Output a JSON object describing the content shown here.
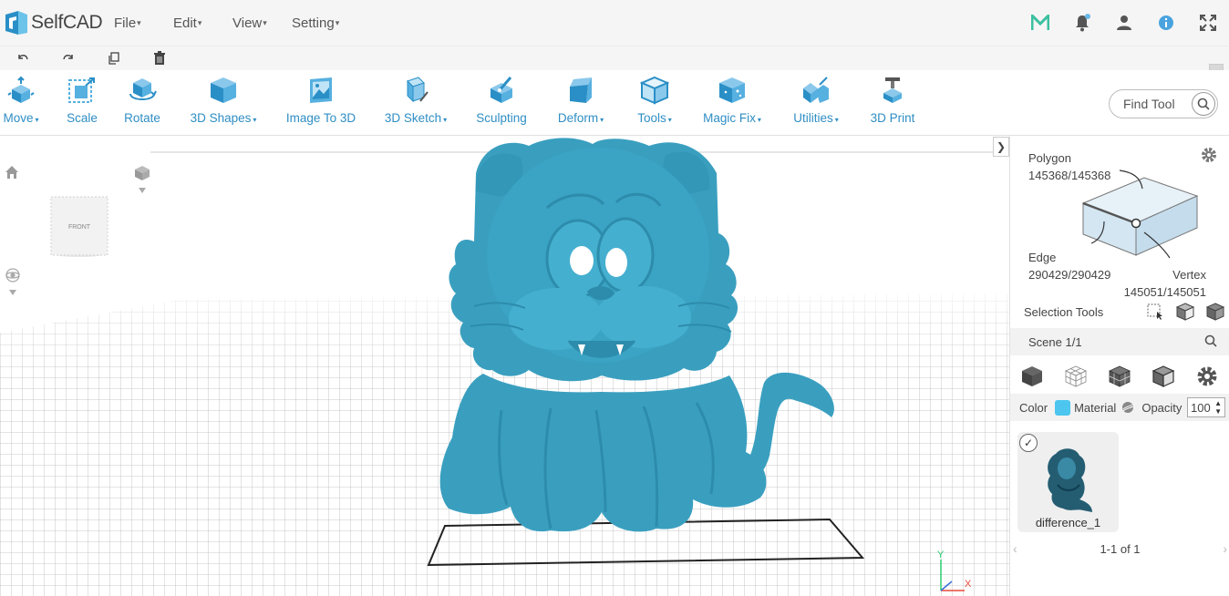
{
  "app": {
    "name": "SelfCAD"
  },
  "menu": [
    {
      "label": "File",
      "caret": "▾"
    },
    {
      "label": "Edit",
      "caret": "▾"
    },
    {
      "label": "View",
      "caret": "▾"
    },
    {
      "label": "Setting",
      "caret": "▾"
    }
  ],
  "tools": [
    {
      "label": "Move",
      "caret": "▾",
      "icon": "move-icon"
    },
    {
      "label": "Scale",
      "caret": "",
      "icon": "scale-icon"
    },
    {
      "label": "Rotate",
      "caret": "",
      "icon": "rotate-icon"
    },
    {
      "label": "3D Shapes",
      "caret": "▾",
      "icon": "cube-icon"
    },
    {
      "label": "Image To 3D",
      "caret": "",
      "icon": "image-icon"
    },
    {
      "label": "3D Sketch",
      "caret": "▾",
      "icon": "sketch-icon"
    },
    {
      "label": "Sculpting",
      "caret": "",
      "icon": "sculpt-icon"
    },
    {
      "label": "Deform",
      "caret": "▾",
      "icon": "deform-icon"
    },
    {
      "label": "Tools",
      "caret": "▾",
      "icon": "tools-icon"
    },
    {
      "label": "Magic Fix",
      "caret": "▾",
      "icon": "magic-fix-icon"
    },
    {
      "label": "Utilities",
      "caret": "▾",
      "icon": "utilities-icon"
    },
    {
      "label": "3D Print",
      "caret": "",
      "icon": "printer-icon"
    }
  ],
  "find_tool": {
    "label": "Find Tool"
  },
  "viewcube": {
    "face": "FRONT"
  },
  "axes": {
    "y": "Y",
    "x": "X"
  },
  "stats": {
    "polygon_label": "Polygon",
    "polygon_value": "145368/145368",
    "edge_label": "Edge",
    "edge_value": "290429/290429",
    "vertex_label": "Vertex",
    "vertex_value": "145051/145051"
  },
  "selection_tools": {
    "label": "Selection Tools"
  },
  "scene": {
    "label": "Scene 1/1"
  },
  "properties": {
    "color_label": "Color",
    "color": "#4cc6ee",
    "material_label": "Material",
    "opacity_label": "Opacity",
    "opacity_value": "100"
  },
  "objects": [
    {
      "name": "difference_1",
      "selected": true
    }
  ],
  "pager": {
    "text": "1-1 of 1",
    "prev": "‹",
    "next": "›"
  },
  "colors": {
    "accent": "#2f8ec4",
    "model": "#3a9fbf"
  }
}
